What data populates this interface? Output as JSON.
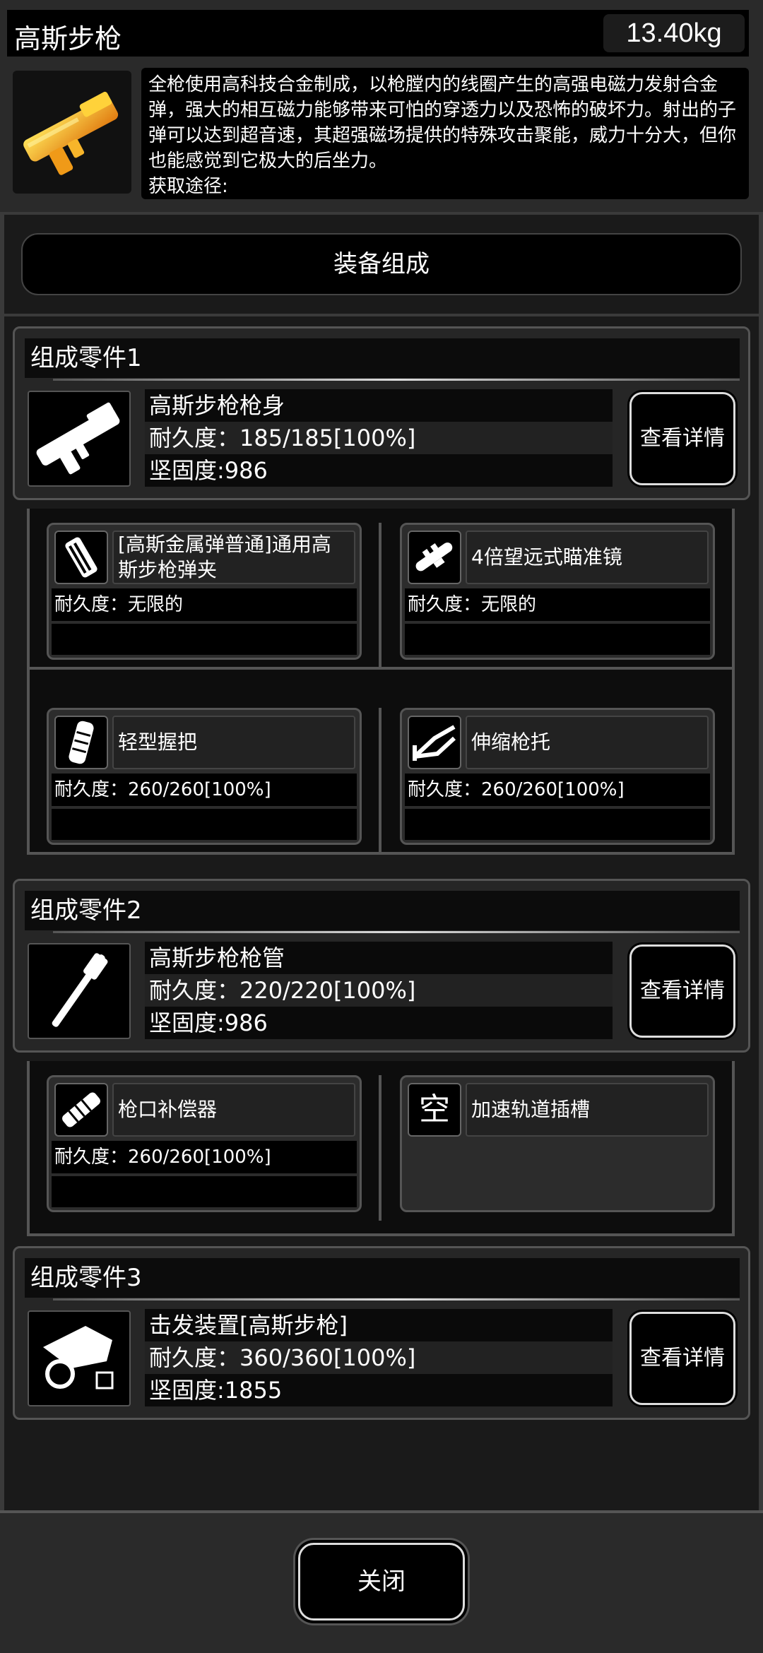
{
  "header": {
    "title": "高斯步枪",
    "weight": "13.40kg",
    "description": "全枪使用高科技合金制成，以枪膛内的线圈产生的高强电磁力发射合金弹，强大的相互磁力能够带来可怕的穿透力以及恐怖的破坏力。射出的子弹可以达到超音速，其超强磁场提供的特殊攻击聚能，威力十分大，但你也能感觉到它极大的后坐力。",
    "source_label": "获取途径:"
  },
  "equip_button": "装备组成",
  "parts": [
    {
      "header": "组成零件1",
      "name": "高斯步枪枪身",
      "durability": "耐久度：185/185[100%]",
      "hardness": "坚固度:986",
      "detail_button": "查看详情",
      "subs": [
        {
          "name": "[高斯金属弹普通]通用高斯步枪弹夹",
          "durability": "耐久度：无限的",
          "icon": "magazine-icon"
        },
        {
          "name": "4倍望远式瞄准镜",
          "durability": "耐久度：无限的",
          "icon": "scope-icon"
        },
        {
          "name": "轻型握把",
          "durability": "耐久度：260/260[100%]",
          "icon": "grip-icon"
        },
        {
          "name": "伸缩枪托",
          "durability": "耐久度：260/260[100%]",
          "icon": "stock-icon"
        }
      ]
    },
    {
      "header": "组成零件2",
      "name": "高斯步枪枪管",
      "durability": "耐久度：220/220[100%]",
      "hardness": "坚固度:986",
      "detail_button": "查看详情",
      "subs": [
        {
          "name": "枪口补偿器",
          "durability": "耐久度：260/260[100%]",
          "icon": "compensator-icon"
        },
        {
          "name": "加速轨道插槽",
          "empty_glyph": "空",
          "icon": "empty-slot-icon"
        }
      ]
    },
    {
      "header": "组成零件3",
      "name": "击发装置[高斯步枪]",
      "durability": "耐久度：360/360[100%]",
      "hardness": "坚固度:1855",
      "detail_button": "查看详情"
    }
  ],
  "close_button": "关闭"
}
